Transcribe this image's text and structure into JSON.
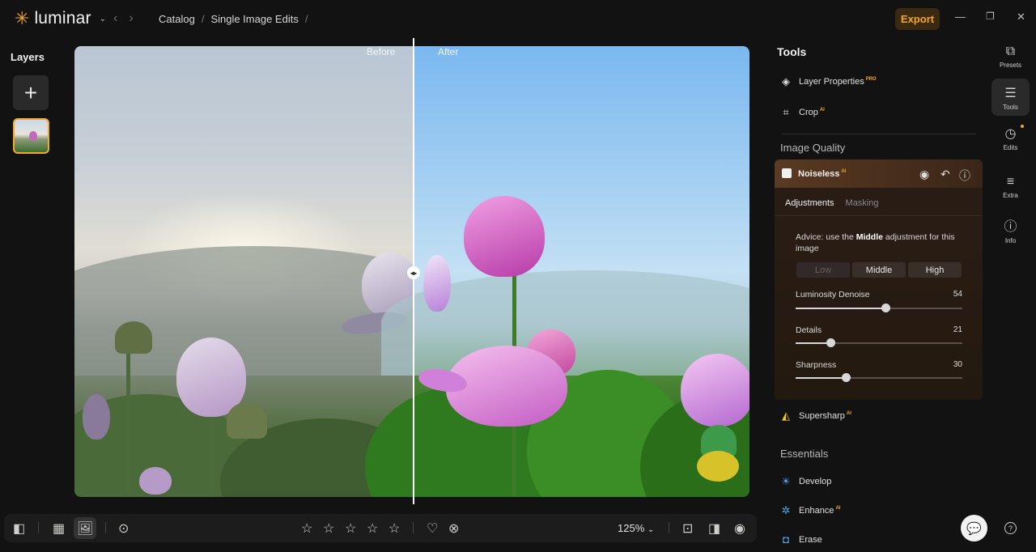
{
  "app": {
    "name": "luminar"
  },
  "breadcrumb": {
    "items": [
      "Catalog",
      "Single Image Edits"
    ],
    "separator": "/"
  },
  "header": {
    "export_label": "Export"
  },
  "layers": {
    "title": "Layers",
    "add_symbol": "+"
  },
  "canvas": {
    "before_label": "Before",
    "after_label": "After"
  },
  "toolbar": {
    "zoom": "125%",
    "rating_stars": 5
  },
  "tools": {
    "title": "Tools",
    "items": [
      {
        "label": "Layer Properties",
        "badge": "PRO",
        "icon": "layers-icon"
      },
      {
        "label": "Crop",
        "badge": "AI",
        "icon": "crop-icon"
      }
    ],
    "image_quality_title": "Image Quality",
    "noiseless": {
      "label": "Noiseless",
      "badge": "AI",
      "tabs": [
        "Adjustments",
        "Masking"
      ],
      "advice_prefix": "Advice: use the",
      "advice_bold": "Middle",
      "advice_suffix": "adjustment for this image",
      "levels": [
        "Low",
        "Middle",
        "High"
      ],
      "sliders": [
        {
          "label": "Luminosity Denoise",
          "value": "54",
          "fraction": 0.54
        },
        {
          "label": "Details",
          "value": "21",
          "fraction": 0.21
        },
        {
          "label": "Sharpness",
          "value": "30",
          "fraction": 0.3
        }
      ]
    },
    "supersharp": {
      "label": "Supersharp",
      "badge": "AI"
    },
    "essentials_title": "Essentials",
    "essentials": [
      {
        "label": "Develop",
        "badge": ""
      },
      {
        "label": "Enhance",
        "badge": "AI"
      },
      {
        "label": "Erase",
        "badge": ""
      }
    ]
  },
  "rail": {
    "items": [
      {
        "label": "Presets",
        "icon": "presets-icon"
      },
      {
        "label": "Tools",
        "icon": "sliders-icon"
      },
      {
        "label": "Edits",
        "icon": "history-icon"
      },
      {
        "label": "Extra",
        "icon": "list-icon"
      },
      {
        "label": "Info",
        "icon": "info-icon"
      }
    ]
  },
  "colors": {
    "accent": "#f5a623",
    "panel": "#2a1d16",
    "background": "#121212"
  }
}
